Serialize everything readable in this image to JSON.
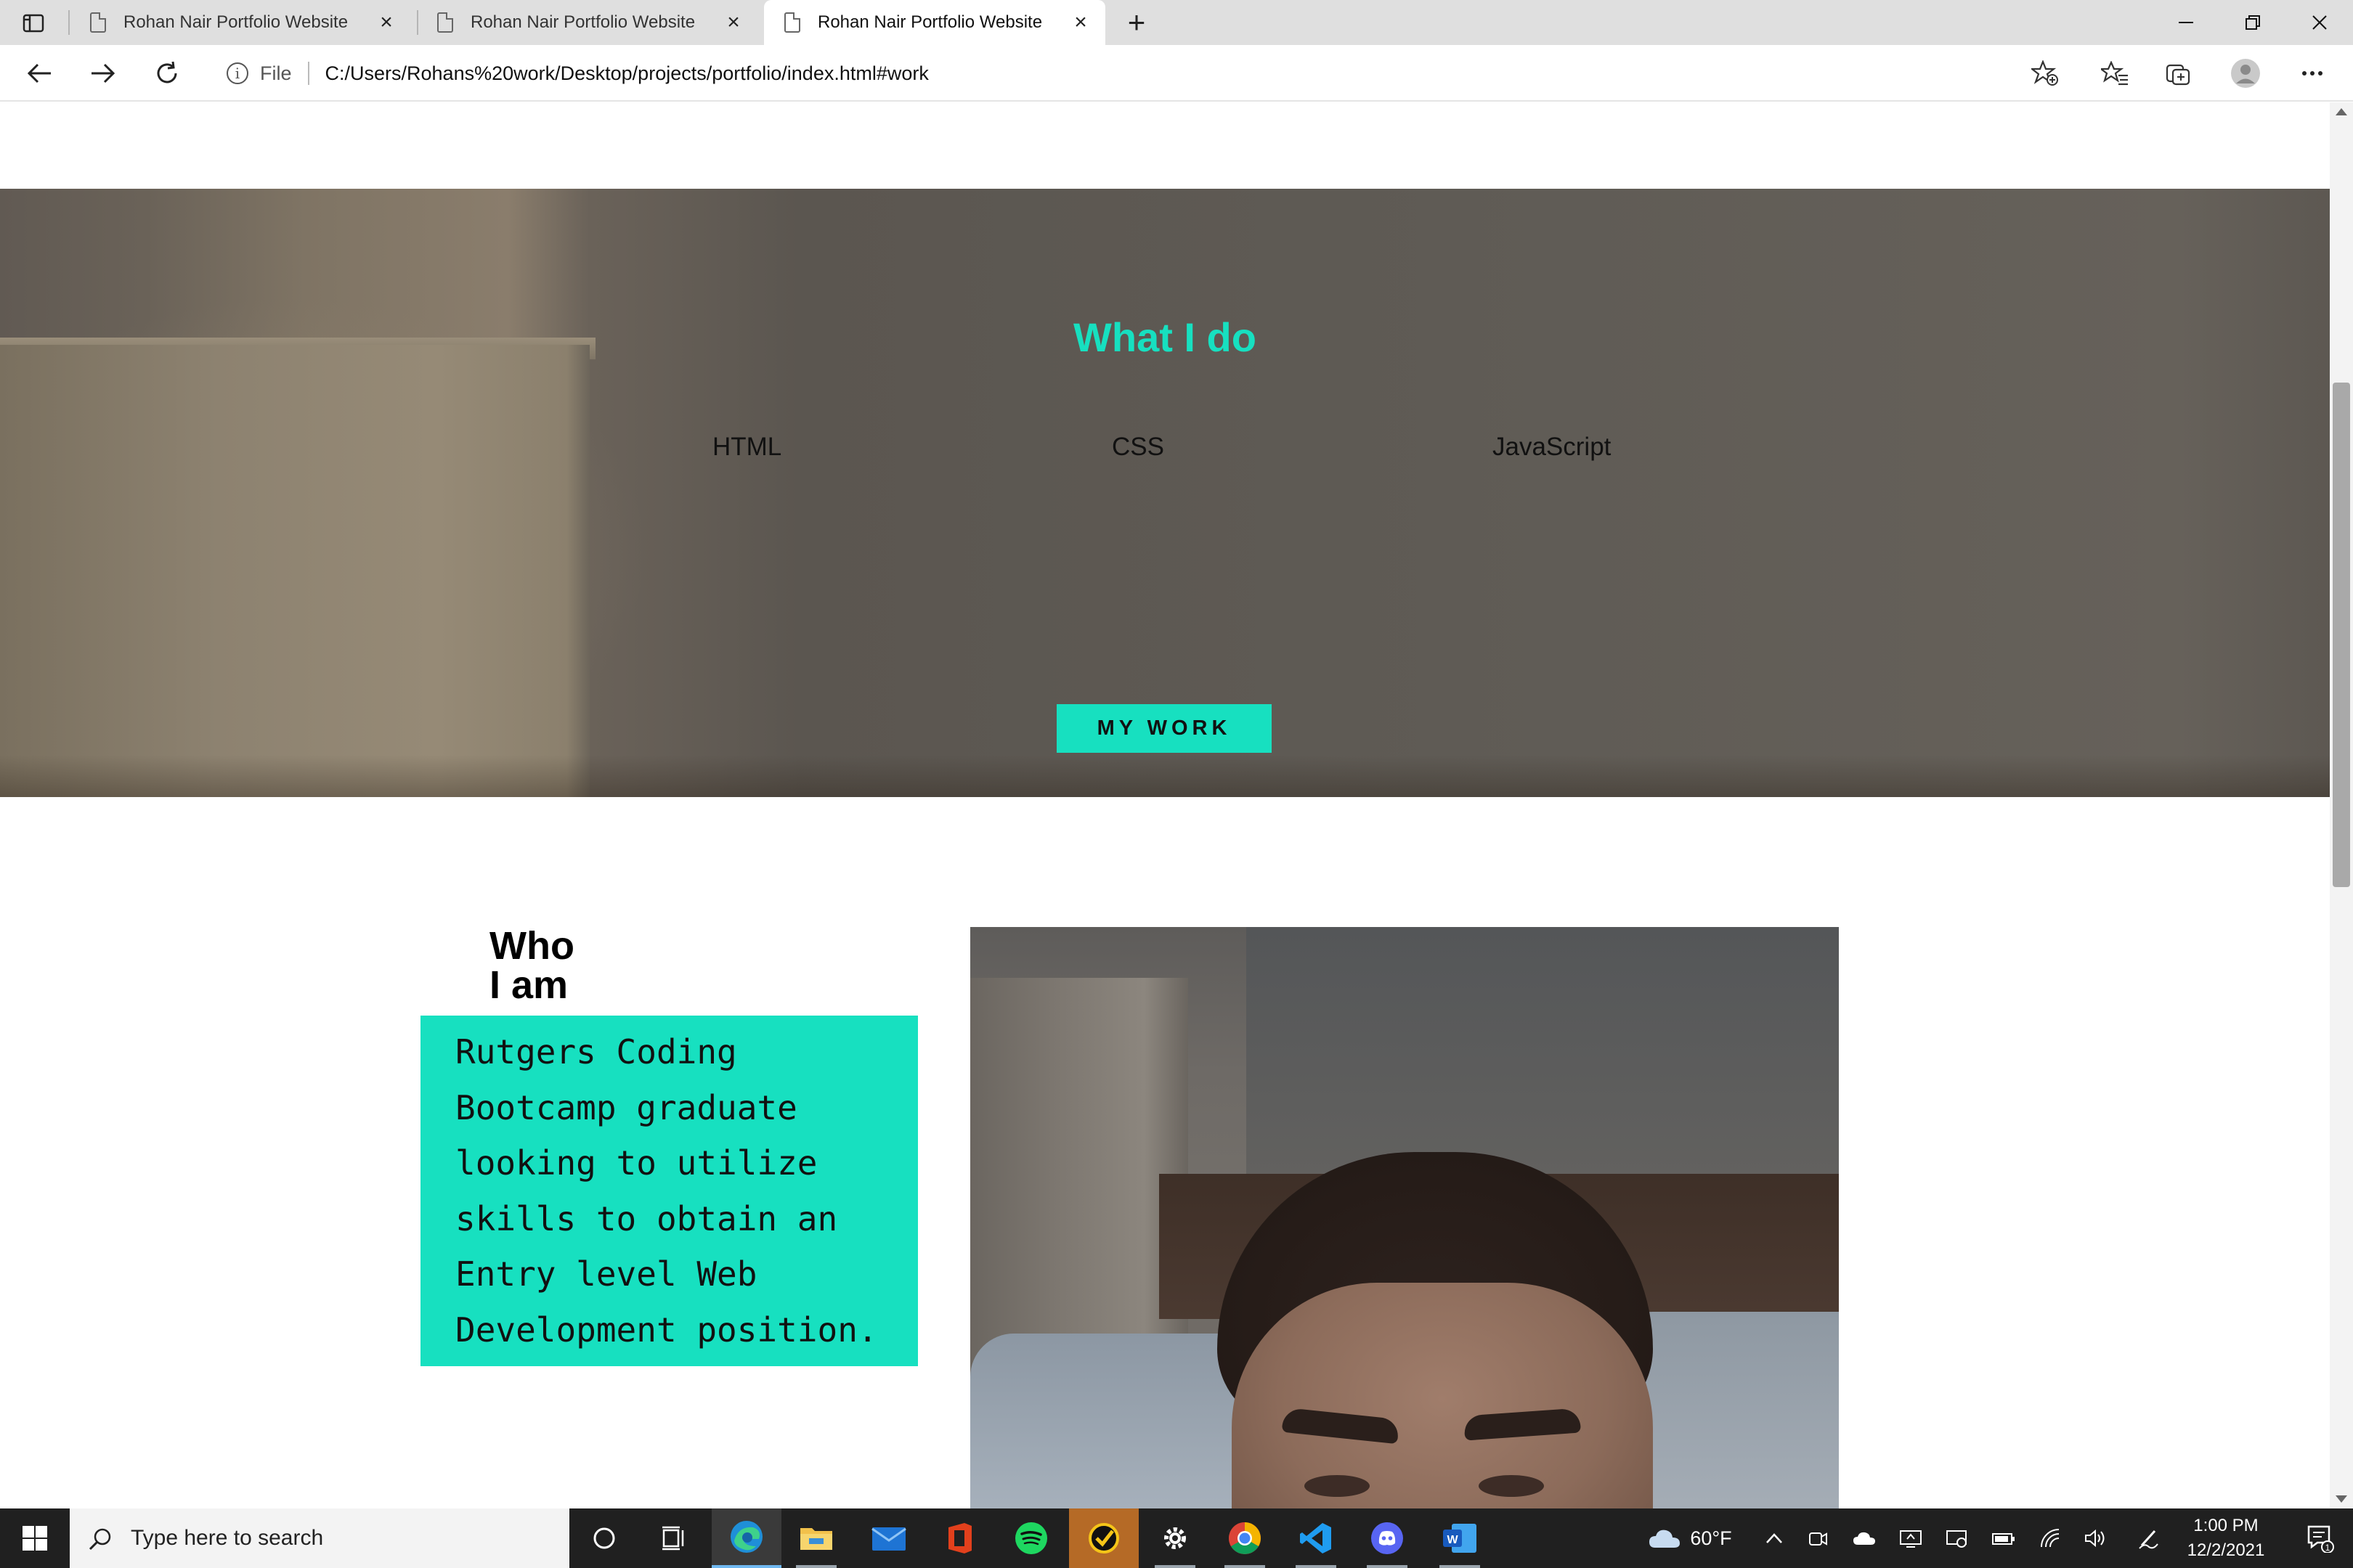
{
  "browser": {
    "tabs": [
      {
        "title": "Rohan Nair Portfolio Website",
        "active": false
      },
      {
        "title": "Rohan Nair Portfolio Website",
        "active": false
      },
      {
        "title": "Rohan Nair Portfolio Website",
        "active": true
      }
    ],
    "address": {
      "scheme_label": "File",
      "url": "C:/Users/Rohans%20work/Desktop/projects/portfolio/index.html#work"
    }
  },
  "page": {
    "work": {
      "title": "What I do",
      "skills": [
        "HTML",
        "CSS",
        "JavaScript"
      ],
      "button": "MY WORK"
    },
    "about": {
      "title_line1": "Who",
      "title_line2": "I am",
      "bio_lines": [
        "Rutgers Coding",
        "Bootcamp graduate",
        "looking to utilize",
        "skills to obtain an",
        "Entry level Web",
        "Development position."
      ]
    },
    "accent_color": "#17e0c0"
  },
  "taskbar": {
    "search_placeholder": "Type here to search",
    "weather": "60°F",
    "time": "1:00 PM",
    "date": "12/2/2021",
    "notification_count": "1",
    "apps": [
      "cortana-icon",
      "task-view-icon",
      "edge-icon",
      "file-explorer-icon",
      "mail-icon",
      "office-icon",
      "spotify-icon",
      "norton-icon",
      "settings-icon",
      "chrome-icon",
      "vscode-icon",
      "discord-icon",
      "word-icon"
    ]
  }
}
